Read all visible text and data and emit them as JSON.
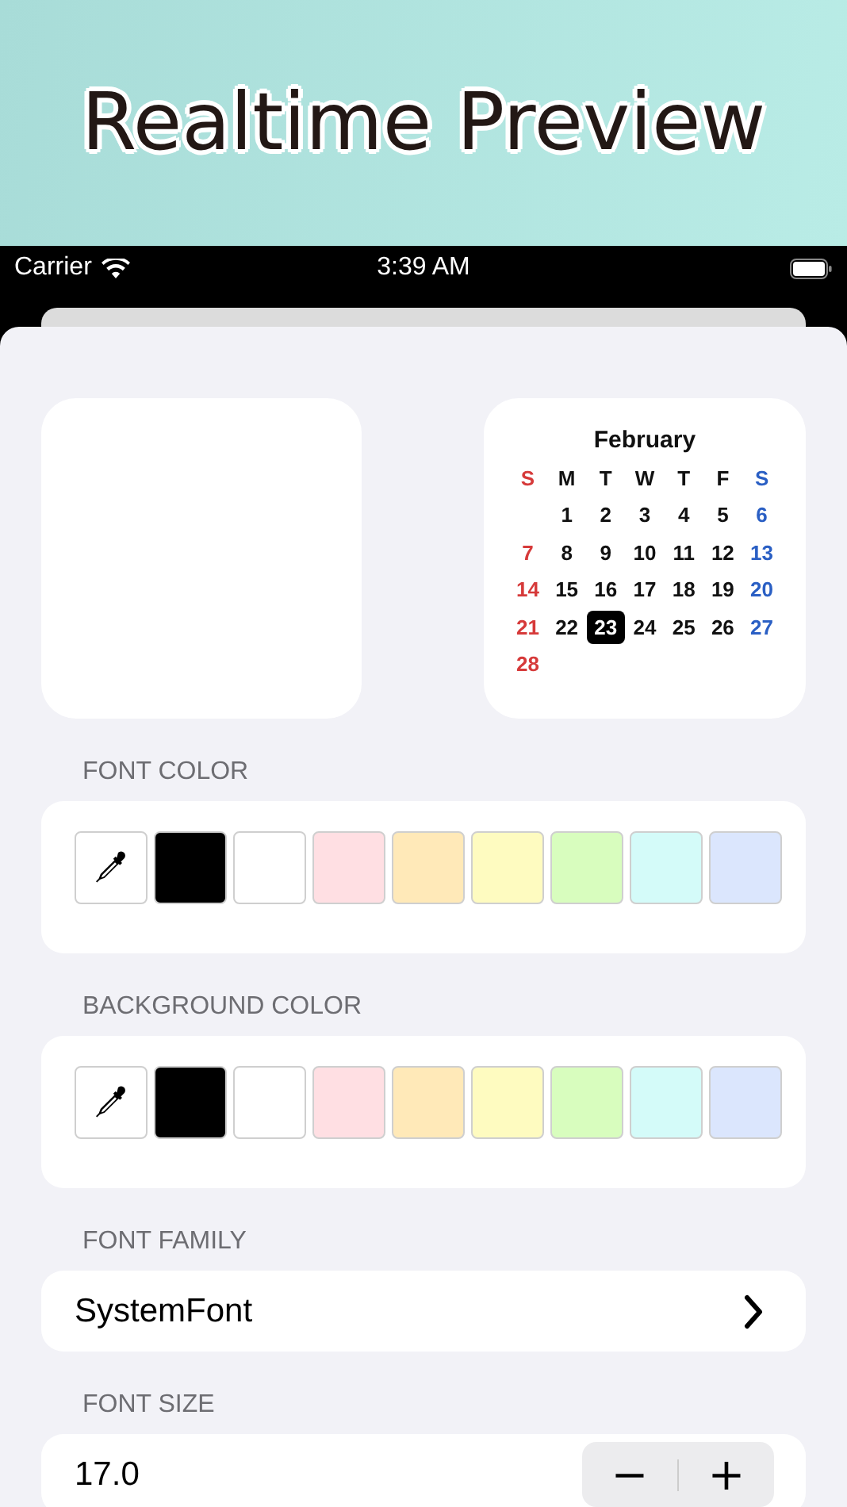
{
  "banner": {
    "title": "Realtime Preview"
  },
  "status_bar": {
    "carrier": "Carrier",
    "time": "3:39 AM"
  },
  "calendar": {
    "month": "February",
    "weekdays": [
      "S",
      "M",
      "T",
      "W",
      "T",
      "F",
      "S"
    ],
    "weeks": [
      {
        "days": [
          {
            "label": "1",
            "selected": false
          },
          {
            "label": "2",
            "selected": false
          },
          {
            "label": "3",
            "selected": false
          },
          {
            "label": "4",
            "selected": false
          },
          {
            "label": "5",
            "selected": false
          },
          {
            "label": "6",
            "selected": false
          }
        ]
      },
      {
        "days": [
          {
            "label": "7",
            "selected": false
          },
          {
            "label": "8",
            "selected": false
          },
          {
            "label": "9",
            "selected": false
          },
          {
            "label": "10",
            "selected": false
          },
          {
            "label": "11",
            "selected": false
          },
          {
            "label": "12",
            "selected": false
          },
          {
            "label": "13",
            "selected": false
          }
        ]
      },
      {
        "days": [
          {
            "label": "14",
            "selected": false
          },
          {
            "label": "15",
            "selected": false
          },
          {
            "label": "16",
            "selected": false
          },
          {
            "label": "17",
            "selected": false
          },
          {
            "label": "18",
            "selected": false
          },
          {
            "label": "19",
            "selected": false
          },
          {
            "label": "20",
            "selected": false
          }
        ]
      },
      {
        "days": [
          {
            "label": "21",
            "selected": false
          },
          {
            "label": "22",
            "selected": false
          },
          {
            "label": "23",
            "selected": true
          },
          {
            "label": "24",
            "selected": false
          },
          {
            "label": "25",
            "selected": false
          },
          {
            "label": "26",
            "selected": false
          },
          {
            "label": "27",
            "selected": false
          }
        ]
      },
      {
        "days": [
          {
            "label": "28",
            "selected": false
          }
        ]
      }
    ]
  },
  "color_sections": [
    {
      "label": "FONT COLOR",
      "swatches": [
        {
          "kind": "picker"
        },
        {
          "kind": "color",
          "color": "#000000"
        },
        {
          "kind": "color",
          "color": "#ffffff"
        },
        {
          "kind": "color",
          "color": "#ffdfe3"
        },
        {
          "kind": "color",
          "color": "#ffe9b8"
        },
        {
          "kind": "color",
          "color": "#fefbc0"
        },
        {
          "kind": "color",
          "color": "#d8fdbe"
        },
        {
          "kind": "color",
          "color": "#d4fbf9"
        },
        {
          "kind": "color",
          "color": "#dbe6fd"
        }
      ]
    },
    {
      "label": "BACKGROUND COLOR",
      "swatches": [
        {
          "kind": "picker"
        },
        {
          "kind": "color",
          "color": "#000000"
        },
        {
          "kind": "color",
          "color": "#ffffff"
        },
        {
          "kind": "color",
          "color": "#ffdfe3"
        },
        {
          "kind": "color",
          "color": "#ffe9b8"
        },
        {
          "kind": "color",
          "color": "#fefbc0"
        },
        {
          "kind": "color",
          "color": "#d8fdbe"
        },
        {
          "kind": "color",
          "color": "#d4fbf9"
        },
        {
          "kind": "color",
          "color": "#dbe6fd"
        }
      ]
    }
  ],
  "font_family": {
    "label": "FONT FAMILY",
    "value": "SystemFont"
  },
  "font_size": {
    "label": "FONT SIZE",
    "value": "17.0",
    "decrement": "−",
    "increment": "+"
  }
}
